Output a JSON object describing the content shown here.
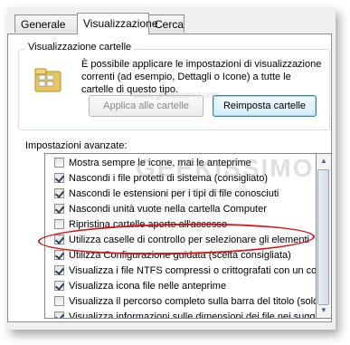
{
  "tabs": [
    {
      "label": "Generale",
      "active": false
    },
    {
      "label": "Visualizzazione",
      "active": true
    },
    {
      "label": "Cerca",
      "active": false
    }
  ],
  "folder_views": {
    "title": "Visualizzazione cartelle",
    "description": "È possibile applicare le impostazioni di visualizzazione correnti (ad esempio, Dettagli o Icone) a tutte le cartelle di questo tipo.",
    "apply_button": "Applica alle cartelle",
    "reset_button": "Reimposta cartelle",
    "icon": "folder-options-icon"
  },
  "advanced": {
    "label": "Impostazioni avanzate:",
    "items": [
      {
        "label": "Mostra sempre le icone, mai le anteprime",
        "checked": false
      },
      {
        "label": "Nascondi i file protetti di sistema (consigliato)",
        "checked": true
      },
      {
        "label": "Nascondi le estensioni per i tipi di file conosciuti",
        "checked": true
      },
      {
        "label": "Nascondi unità vuote nella cartella Computer",
        "checked": true
      },
      {
        "label": "Ripristina cartelle aperte all'accesso",
        "checked": false
      },
      {
        "label": "Utilizza caselle di controllo per selezionare gli elementi",
        "checked": true
      },
      {
        "label": "Utilizza Configurazione guidata (scelta consigliata)",
        "checked": true
      },
      {
        "label": "Visualizza i file NTFS compressi o crittografati con un colo",
        "checked": true
      },
      {
        "label": "Visualizza icona file nelle anteprime",
        "checked": true
      },
      {
        "label": "Visualizza il percorso completo sulla barra del titolo (solo te",
        "checked": false
      },
      {
        "label": "Visualizza informazioni sulle dimensioni dei file nei suggerir",
        "checked": true
      }
    ]
  },
  "watermark": {
    "main": "GEEKISSIMO",
    "small": "www.geekissimo.com"
  },
  "colors": {
    "annotation": "#d81414",
    "default_button_border": "#3c7fb1"
  }
}
